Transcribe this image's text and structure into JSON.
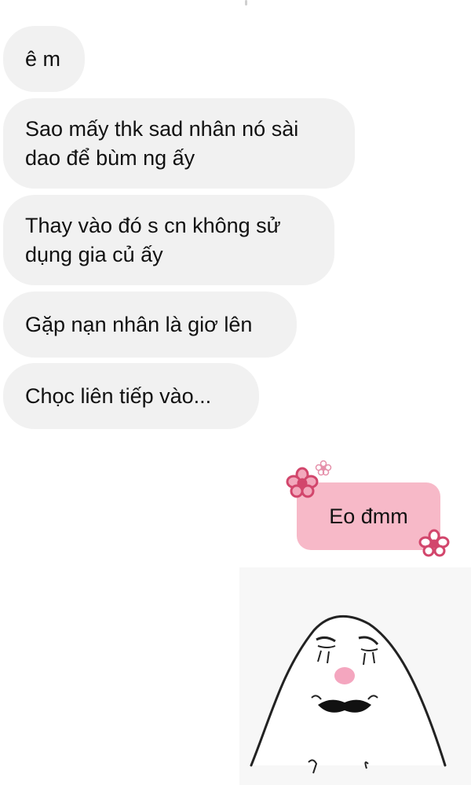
{
  "messages": {
    "received": [
      {
        "text": "ê m"
      },
      {
        "text": "Sao mấy thk sad nhân nó sài\ndao để bùm ng ấy"
      },
      {
        "text": "Thay vào đó s cn không sử\ndụng gia củ ấy"
      },
      {
        "text": "Gặp nạn nhân là giơ lên"
      },
      {
        "text": "Chọc liên tiếp vào..."
      }
    ],
    "sent": [
      {
        "text": "Eo đmm"
      }
    ]
  },
  "colors": {
    "received_bubble": "#f1f1f1",
    "sent_bubble": "#f7b9c8",
    "flower": "#d2466c",
    "flower_light": "#f2a8bc",
    "sticker_blush": "#f4a6bf"
  },
  "icons": {
    "flower_large": "flower-icon",
    "flower_small": "small-flower-icon",
    "sticker": "crying-blob-sticker"
  }
}
